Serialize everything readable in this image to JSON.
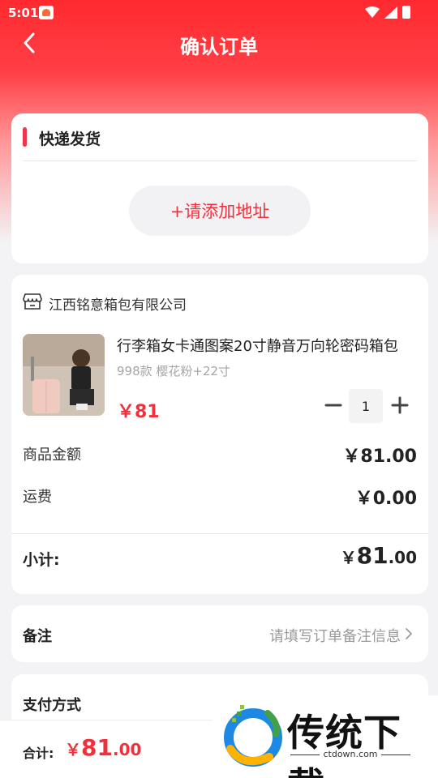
{
  "status_bar": {
    "time": "5:01"
  },
  "header": {
    "title": "确认订单"
  },
  "shipping": {
    "title": "快递发货",
    "add_address_label": "+请添加地址"
  },
  "order": {
    "store_name": "江西铭意箱包有限公司",
    "product": {
      "title": "行李箱女卡通图案20寸静音万向轮密码箱包",
      "spec": "998款 樱花粉+22寸",
      "price": "￥81",
      "quantity": "1"
    },
    "goods_amount_label": "商品金额",
    "goods_amount_value": "￥81.00",
    "shipping_fee_label": "运费",
    "shipping_fee_value": "￥0.00",
    "subtotal_label": "小计:",
    "subtotal_currency": "￥",
    "subtotal_integer": "81",
    "subtotal_decimal": ".00"
  },
  "note": {
    "label": "备注",
    "placeholder": "请填写订单备注信息"
  },
  "payment": {
    "label": "支付方式"
  },
  "footer": {
    "total_label": "合计:",
    "total_currency": "￥",
    "total_integer": "81",
    "total_decimal": ".00"
  },
  "watermark": {
    "title": "传统下载",
    "url": "ctdown.com"
  },
  "colors": {
    "accent_red": "#f0303b",
    "header_gradient_top": "#ff2a2f",
    "page_background": "#f3f3f5"
  },
  "icons": {
    "back": "back-chevron-icon",
    "store": "store-icon",
    "minus": "minus-icon",
    "plus": "plus-icon",
    "note_arrow": "chevron-right-icon"
  }
}
